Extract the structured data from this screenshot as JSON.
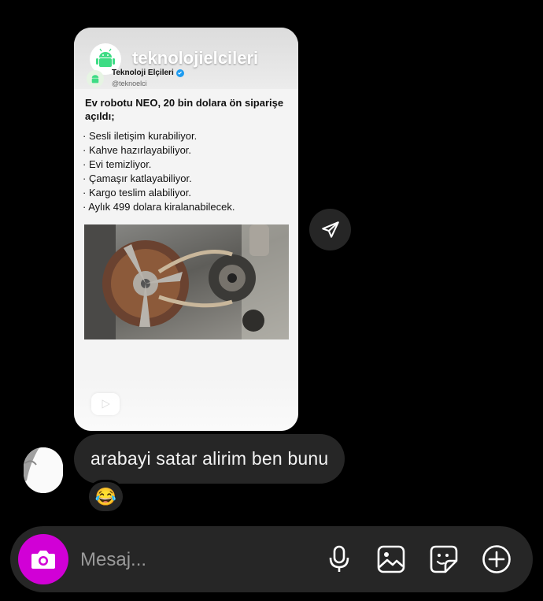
{
  "shared_reel": {
    "account_name": "teknolojielcileri",
    "tweet_display_name": "Teknoloji Elçileri",
    "tweet_handle": "@teknoelci",
    "headline": "Ev robotu NEO, 20 bin dolara ön siparişe açıldı;",
    "bullets": [
      "Sesli iletişim kurabiliyor.",
      "Kahve hazırlayabiliyor.",
      "Evi temizliyor.",
      "Çamaşır katlayabiliyor.",
      "Kargo teslim alabiliyor.",
      "Aylık 499 dolara kiralanabilecek."
    ]
  },
  "message": {
    "text": "arabayi satar alirim ben bunu",
    "reaction": "😂"
  },
  "composer": {
    "placeholder": "Mesaj..."
  },
  "icons": {
    "share": "send-icon",
    "camera": "camera-icon",
    "mic": "microphone-icon",
    "gallery": "image-icon",
    "sticker": "sticker-icon",
    "add": "plus-circle-icon"
  },
  "colors": {
    "camera_button": "#d100d6",
    "bubble": "#262626",
    "background": "#000000"
  }
}
